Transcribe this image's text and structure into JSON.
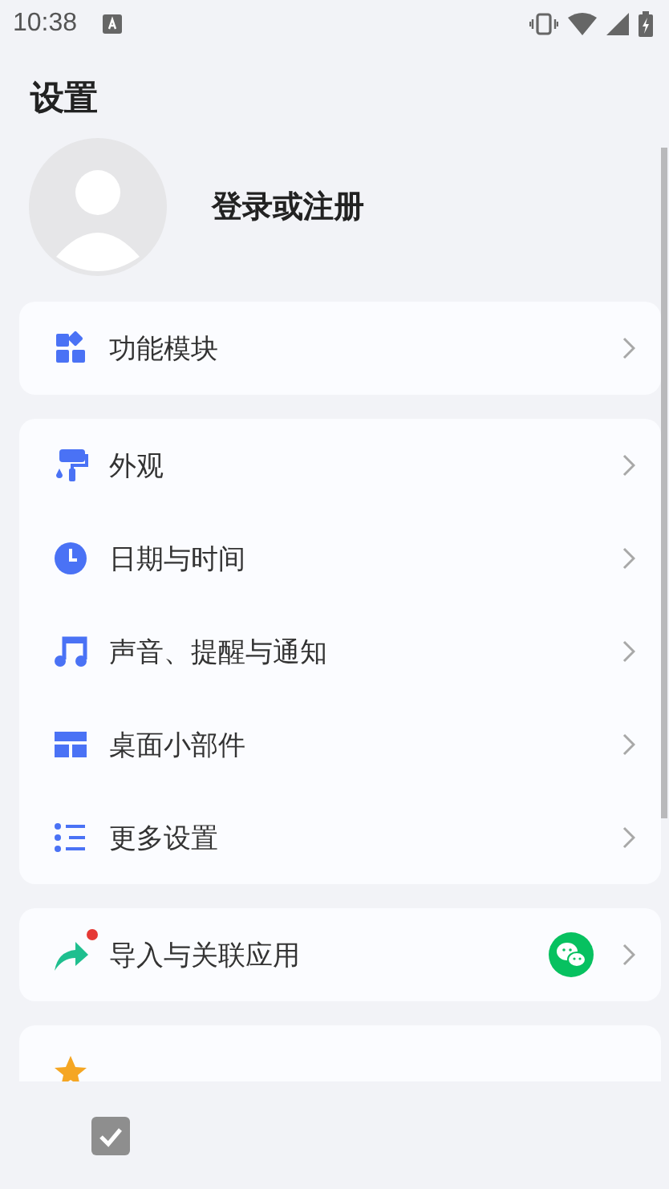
{
  "status_bar": {
    "time": "10:38"
  },
  "title": "设置",
  "profile": {
    "label": "登录或注册"
  },
  "groups": [
    {
      "items": [
        {
          "kind": "link",
          "label": "功能模块"
        }
      ]
    },
    {
      "items": [
        {
          "kind": "link",
          "label": "外观"
        },
        {
          "kind": "link",
          "label": "日期与时间"
        },
        {
          "kind": "link",
          "label": "声音、提醒与通知"
        },
        {
          "kind": "link",
          "label": "桌面小部件"
        },
        {
          "kind": "link",
          "label": "更多设置"
        }
      ]
    },
    {
      "items": [
        {
          "kind": "link",
          "label": "导入与关联应用",
          "badge": true,
          "app_linked": true
        }
      ]
    },
    {
      "items": [
        {
          "kind": "peek"
        }
      ]
    }
  ]
}
